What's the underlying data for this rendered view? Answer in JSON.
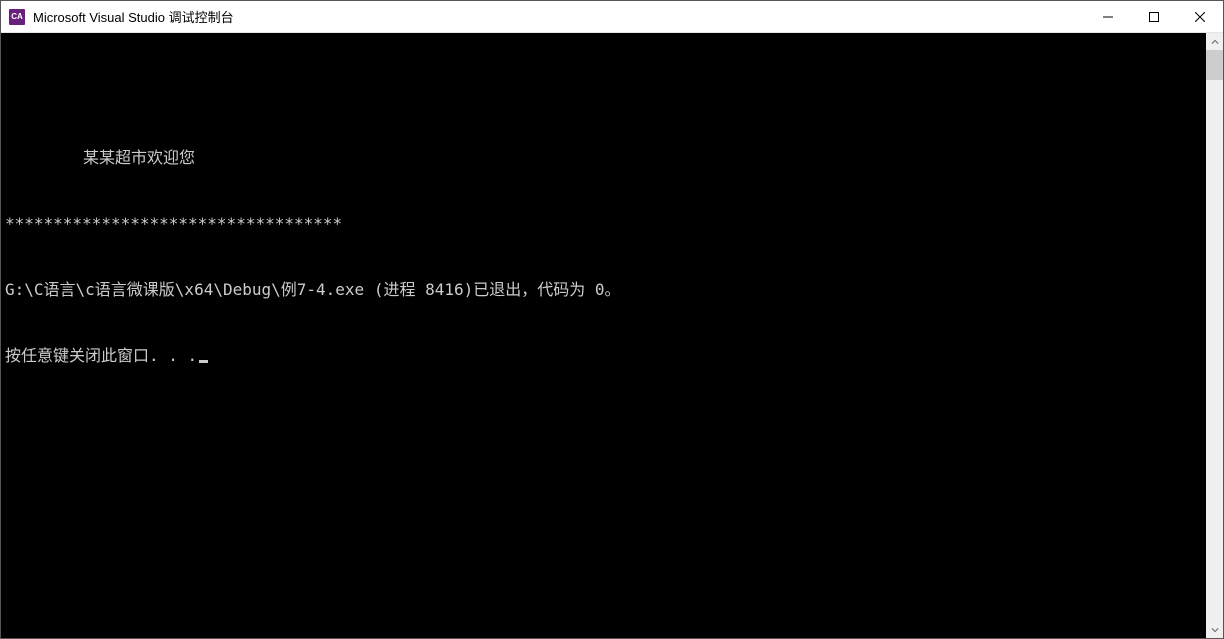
{
  "titlebar": {
    "icon_label": "CA",
    "title": "Microsoft Visual Studio 调试控制台"
  },
  "console": {
    "lines": {
      "welcome": "某某超市欢迎您",
      "stars": "***********************************",
      "exit": "G:\\C语言\\c语言微课版\\x64\\Debug\\例7-4.exe (进程 8416)已退出，代码为 0。",
      "prompt": "按任意键关闭此窗口. . ."
    }
  }
}
